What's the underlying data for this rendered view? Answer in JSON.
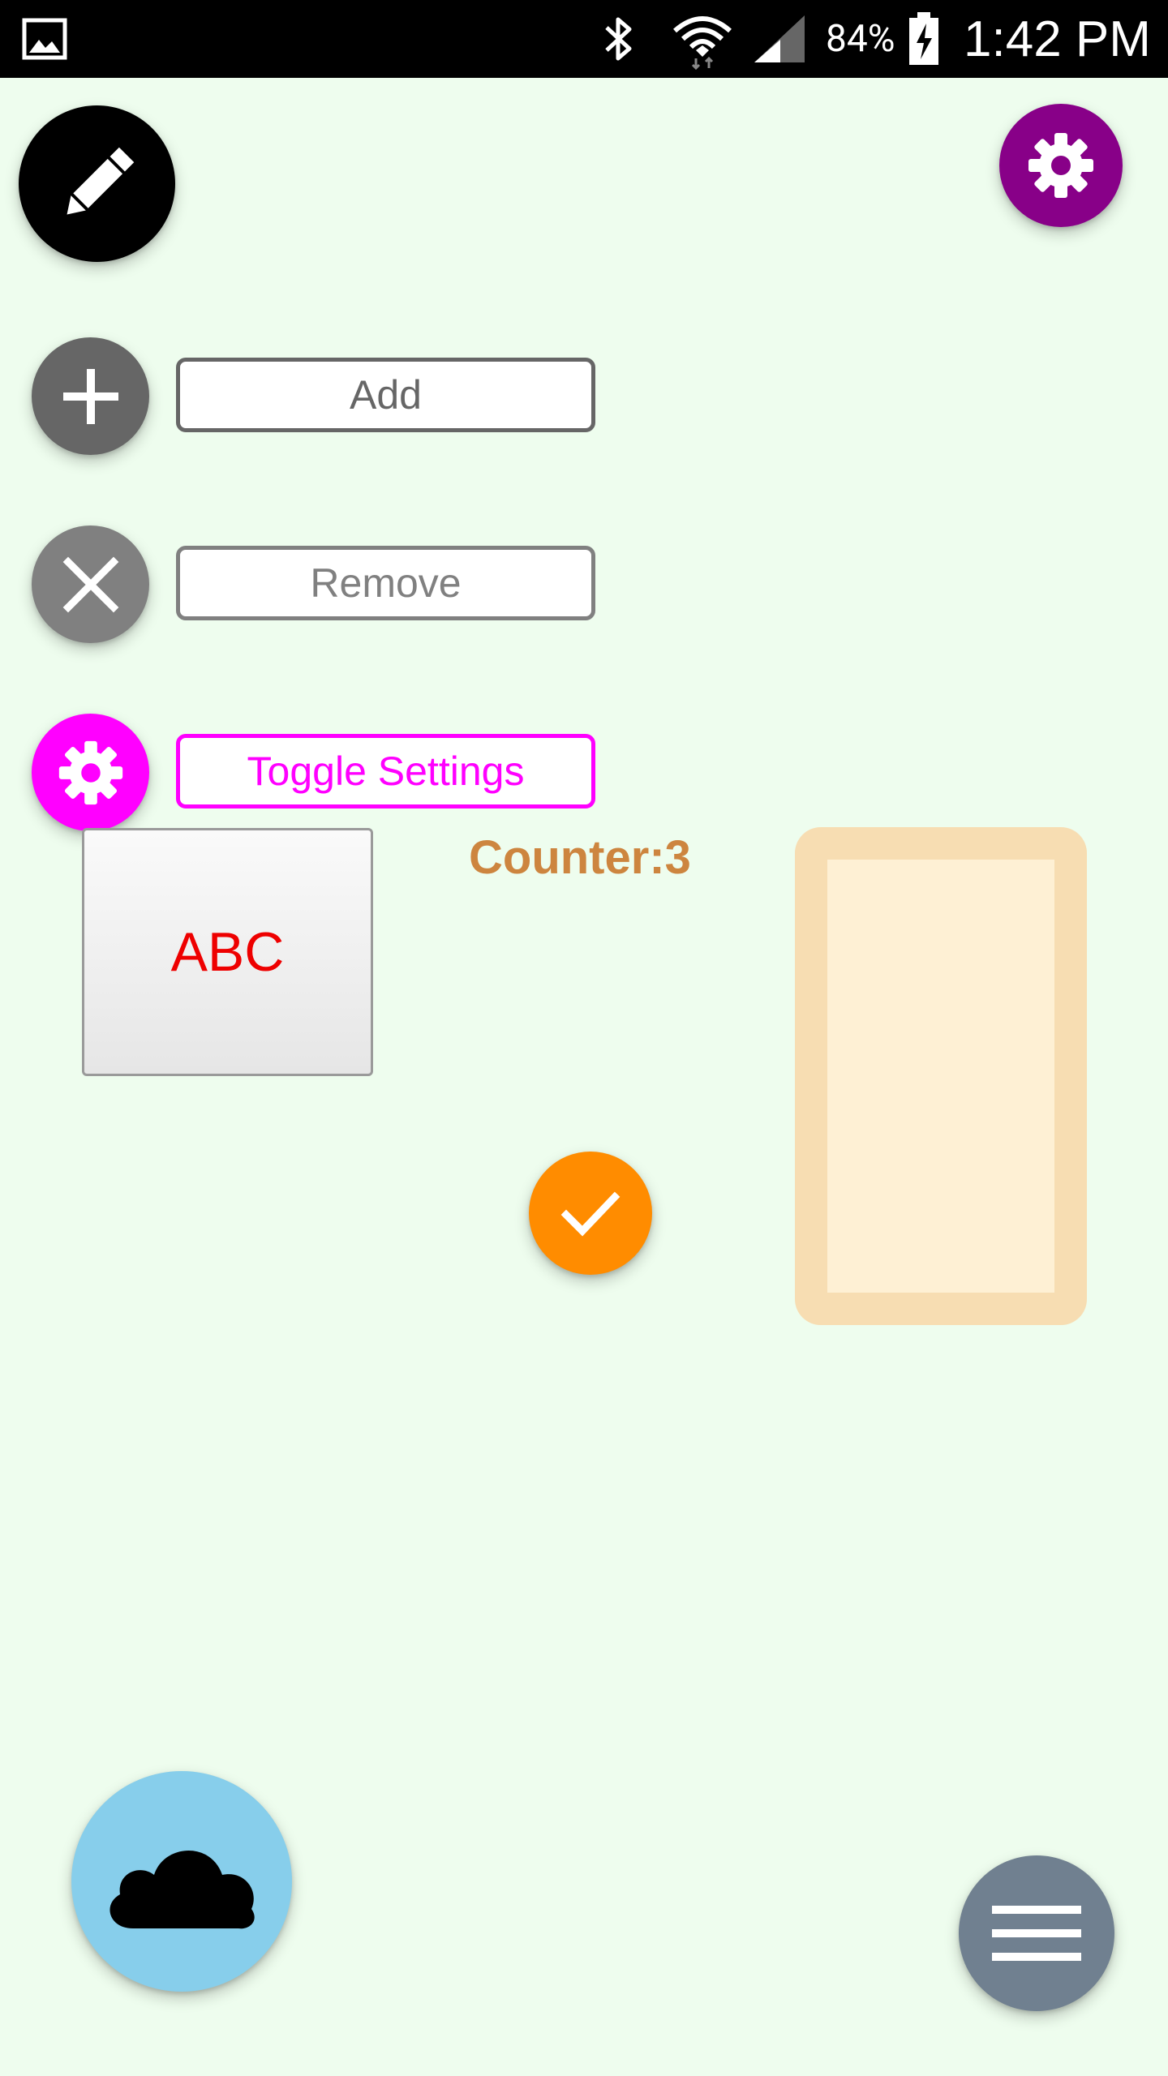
{
  "status_bar": {
    "battery_percent": "84%",
    "time": "1:42 PM",
    "icons": [
      "gallery-icon",
      "bluetooth-icon",
      "wifi-icon",
      "signal-icon",
      "battery-charging-icon"
    ]
  },
  "fabs": {
    "edit": {
      "icon": "pencil-icon",
      "color": "#000000"
    },
    "settings_top": {
      "icon": "gear-icon",
      "color": "#880088"
    },
    "add": {
      "icon": "plus-icon",
      "color": "#666666"
    },
    "remove": {
      "icon": "close-icon",
      "color": "#808080"
    },
    "toggle": {
      "icon": "gear-icon",
      "color": "#FF00FF"
    },
    "confirm": {
      "icon": "check-icon",
      "color": "#FF8C00"
    },
    "cloud": {
      "icon": "cloud-icon",
      "color": "#87CEEB"
    },
    "menu": {
      "icon": "hamburger-menu-icon",
      "color": "#708090"
    }
  },
  "buttons": {
    "add_label": "Add",
    "remove_label": "Remove",
    "toggle_label": "Toggle Settings"
  },
  "abc_box": {
    "label": "ABC",
    "color": "#EE0000"
  },
  "counter": {
    "text": "Counter:3",
    "color": "#CD853F"
  },
  "frame": {
    "border_color": "#F7DDB2",
    "fill_color": "#FEF0D4"
  },
  "background_color": "#EEFDEE"
}
